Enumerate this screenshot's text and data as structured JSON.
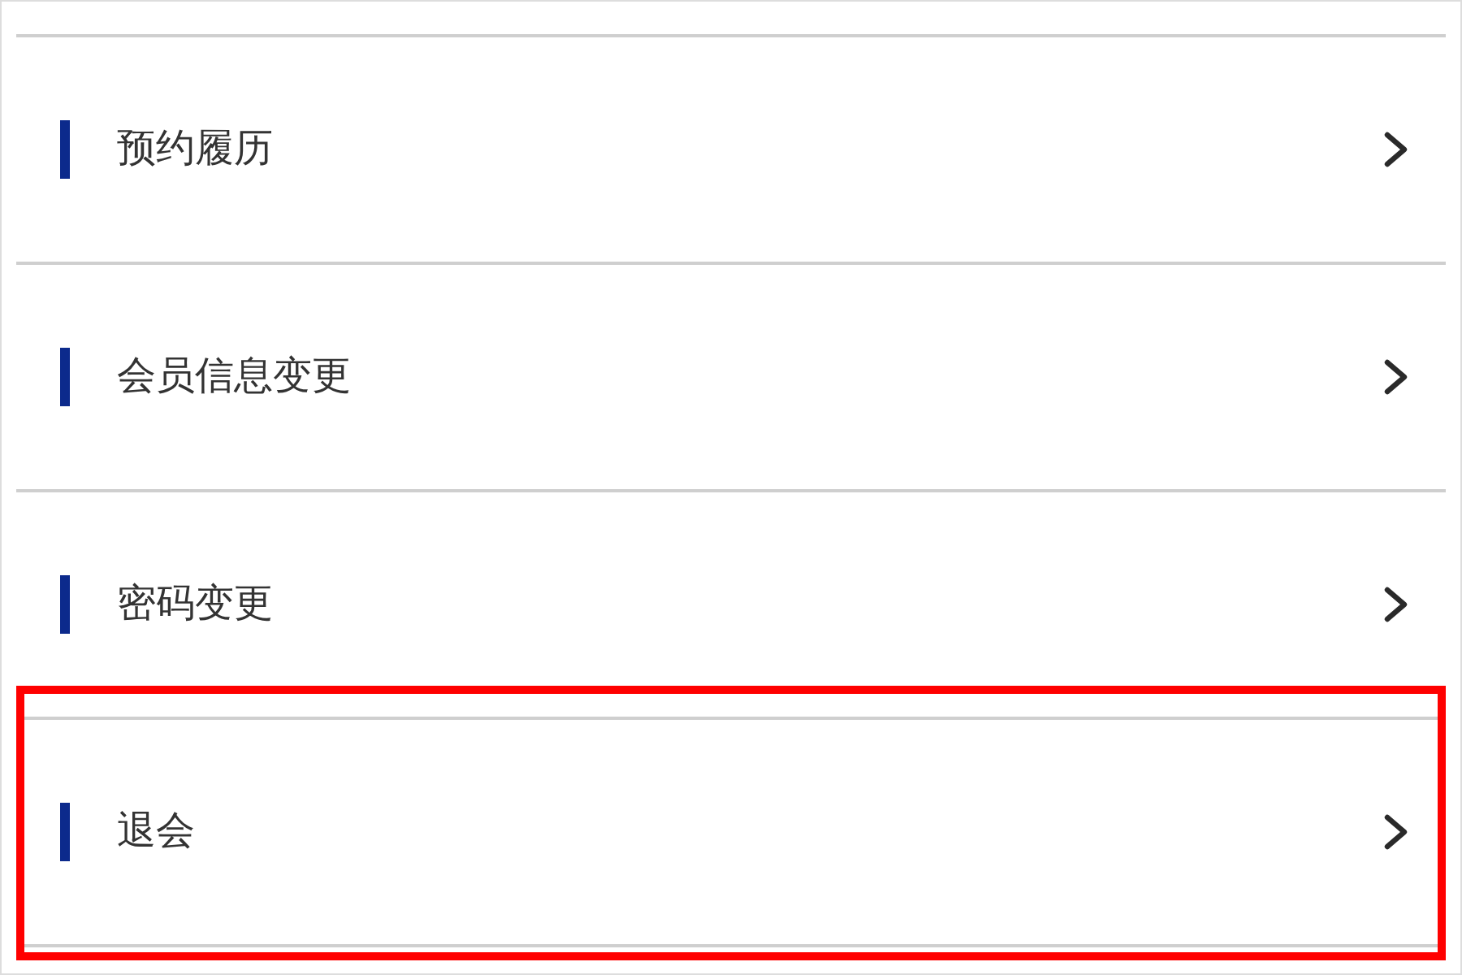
{
  "items": [
    {
      "label": "预约履历",
      "highlighted": false
    },
    {
      "label": "会员信息变更",
      "highlighted": false
    },
    {
      "label": "密码变更",
      "highlighted": false
    },
    {
      "label": "退会",
      "highlighted": true
    }
  ]
}
